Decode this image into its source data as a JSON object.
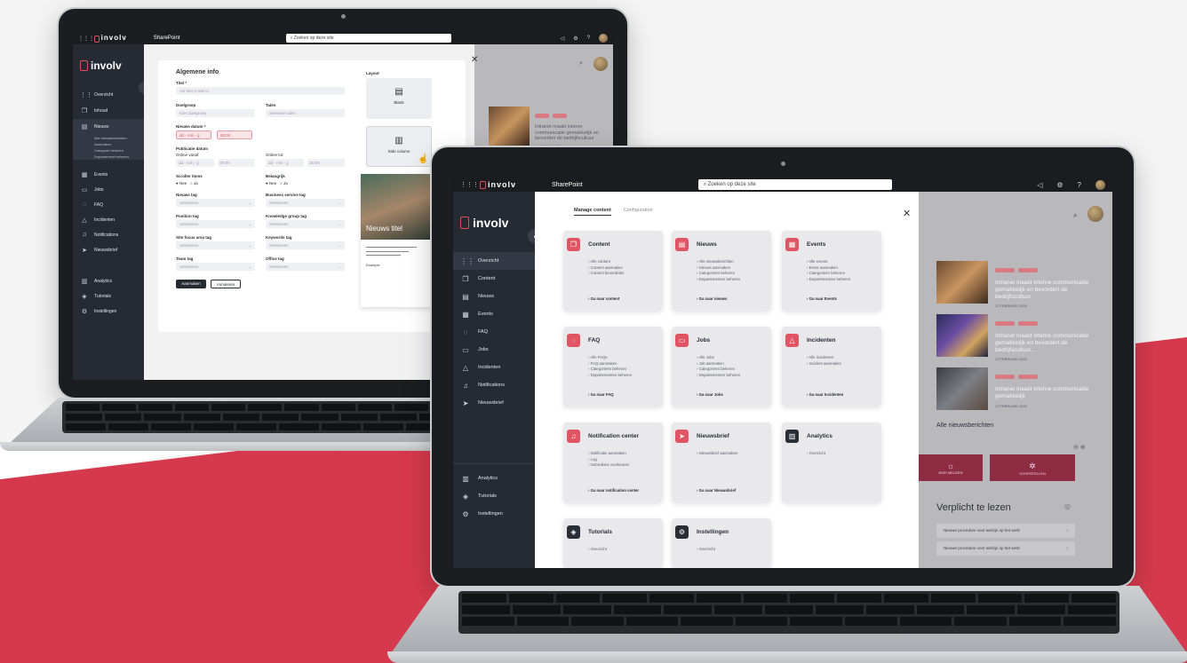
{
  "brand": {
    "logo_text": "involv",
    "logo_sub": "INTRANET MADE SIMPLE",
    "app_name": "SharePoint",
    "search_placeholder": "Zoeken op deze site"
  },
  "front": {
    "tabs": [
      "Manage content",
      "Configuration"
    ],
    "sidebar": [
      {
        "icon": "grid-icon",
        "glyph": "⋮⋮",
        "label": "Overzicht",
        "active": true
      },
      {
        "icon": "content-icon",
        "glyph": "❐",
        "label": "Content"
      },
      {
        "icon": "news-icon",
        "glyph": "▤",
        "label": "Nieuws"
      },
      {
        "icon": "calendar-icon",
        "glyph": "▦",
        "label": "Events"
      },
      {
        "icon": "faq-icon",
        "glyph": "◌",
        "label": "FAQ"
      },
      {
        "icon": "briefcase-icon",
        "glyph": "▭",
        "label": "Jobs"
      },
      {
        "icon": "warning-icon",
        "glyph": "△",
        "label": "Incidenten"
      },
      {
        "icon": "bell-icon",
        "glyph": "♫",
        "label": "Notifications"
      },
      {
        "icon": "send-icon",
        "glyph": "➤",
        "label": "Nieuwsbrief"
      }
    ],
    "sidebar_bottom": [
      {
        "icon": "analytics-icon",
        "glyph": "▥",
        "label": "Analytics"
      },
      {
        "icon": "tutorial-icon",
        "glyph": "◈",
        "label": "Tutorials"
      },
      {
        "icon": "settings-icon",
        "glyph": "⚙",
        "label": "Instellingen"
      }
    ],
    "tiles": [
      {
        "name": "Content",
        "icon": "content-icon",
        "glyph": "❐",
        "links": [
          "Alle content",
          "Content aanmaken",
          "Content beoordelen"
        ],
        "go": "Ga naar content"
      },
      {
        "name": "Nieuws",
        "icon": "news-icon",
        "glyph": "▤",
        "links": [
          "Alle nieuwsberichten",
          "Nieuws aanmaken",
          "Categorieën beheren",
          "Departementen beheren"
        ],
        "go": "Ga naar nieuws"
      },
      {
        "name": "Events",
        "icon": "calendar-icon",
        "glyph": "▦",
        "links": [
          "Alle events",
          "Event aanmaken",
          "Categorieën beheren",
          "Departementen beheren"
        ],
        "go": "Ga naar Events"
      },
      {
        "name": "FAQ",
        "icon": "faq-icon",
        "glyph": "◌",
        "links": [
          "Alle FAQs",
          "FAQ aanmaken",
          "Categorieën beheren",
          "Departementen beheren"
        ],
        "go": "Ga naar FAQ"
      },
      {
        "name": "Jobs",
        "icon": "briefcase-icon",
        "glyph": "▭",
        "links": [
          "Alle Jobs",
          "Job aanmaken",
          "Categorieën beheren",
          "Departementen beheren"
        ],
        "go": "Ga naar Jobs"
      },
      {
        "name": "Incidenten",
        "icon": "warning-icon",
        "glyph": "△",
        "links": [
          "Alle incidenten",
          "Incident aanmaken"
        ],
        "go": "Ga naar Incidenten"
      },
      {
        "name": "Notification center",
        "icon": "bell-icon",
        "glyph": "♫",
        "links": [
          "Notificatie aanmaken",
          "Log",
          "Gebruikers voorkeuren"
        ],
        "go": "Ga naar notification center"
      },
      {
        "name": "Nieuwsbrief",
        "icon": "send-icon",
        "glyph": "➤",
        "links": [
          "Nieuwsbrief aanmaken"
        ],
        "go": "Ga naar Nieuwsbrief"
      },
      {
        "name": "Analytics",
        "icon": "analytics-icon",
        "glyph": "▥",
        "links": [
          "Overzicht"
        ],
        "go": "",
        "dark": true
      },
      {
        "name": "Tutorials",
        "icon": "tutorial-icon",
        "glyph": "◈",
        "links": [
          "Overzicht"
        ],
        "go": "",
        "dark": true
      },
      {
        "name": "Instellingen",
        "icon": "settings-icon",
        "glyph": "⚙",
        "links": [
          "Overzicht"
        ],
        "go": "",
        "dark": true
      }
    ],
    "right": {
      "news": [
        {
          "title": "Intranet maakt interne communicatie gemakkelijk en bevordert de bedrijfscultuur",
          "date": "12 FEBRUARI 2024"
        },
        {
          "title": "Intranet maakt interne communicatie gemakkelijk en bevordert de bedrijfscultuur...",
          "date": "12 FEBRUARI 2024"
        },
        {
          "title": "Intranet maakt interne communicatie gemakkelijk",
          "date": "12 FEBRUARI 2024"
        }
      ],
      "all_news": "Alle nieuwsberichten",
      "btn_left": "IDEE MELDEN",
      "btn_right": "VOORSTELLEN",
      "required_title": "Verplicht te lezen",
      "required_items": [
        "Nieuwe procedure voor welzijn op het werk",
        "Nieuwe procedure voor welzijn op het werk"
      ]
    }
  },
  "back": {
    "sidebar": [
      {
        "icon": "grid-icon",
        "glyph": "⋮⋮",
        "label": "Overzicht"
      },
      {
        "icon": "content-icon",
        "glyph": "❐",
        "label": "Inhoud"
      },
      {
        "icon": "news-icon",
        "glyph": "▤",
        "label": "Nieuws",
        "active": true
      }
    ],
    "subitems": [
      "Alle nieuwsberichten",
      "Aanmaken",
      "Categorie beheren",
      "Departement beheren"
    ],
    "sidebar2": [
      {
        "icon": "calendar-icon",
        "glyph": "▦",
        "label": "Events"
      },
      {
        "icon": "briefcase-icon",
        "glyph": "▭",
        "label": "Jobs"
      },
      {
        "icon": "faq-icon",
        "glyph": "◌",
        "label": "FAQ"
      },
      {
        "icon": "warning-icon",
        "glyph": "△",
        "label": "Incidenten"
      },
      {
        "icon": "bell-icon",
        "glyph": "♫",
        "label": "Notifications"
      },
      {
        "icon": "send-icon",
        "glyph": "➤",
        "label": "Nieuwsbrief"
      }
    ],
    "sidebar_bottom": [
      {
        "icon": "analytics-icon",
        "glyph": "▥",
        "label": "Analytics"
      },
      {
        "icon": "tutorial-icon",
        "glyph": "◈",
        "label": "Tutorials"
      },
      {
        "icon": "settings-icon",
        "glyph": "⚙",
        "label": "Instellingen"
      }
    ],
    "form": {
      "heading": "Algemene info",
      "title_label": "Titel *",
      "title_ph": "Vul hier je titel in",
      "doelgroep": "Doelgroep",
      "doelgroep_ph": "Kies doelgroep",
      "talen": "Talen",
      "talen_ph": "Selecteer talen",
      "date_label": "Nieuws datum *",
      "date_ph": "dd - mm - jj",
      "time_ph": "00:00",
      "publish_label": "Publicatie datum",
      "from_label": "Online vanaf:",
      "to_label": "Online tot:",
      "scroller": "Scroller items",
      "important": "Belangrijk",
      "yes": "Nee",
      "no": "Ja",
      "fields": [
        [
          "Nieuws tag",
          "Business service tag"
        ],
        [
          "Position tag",
          "Knowledge group tag"
        ],
        [
          "Site focus area tag",
          "Keywords tag"
        ],
        [
          "Team tag",
          "Office tag"
        ]
      ],
      "select_ph": "Selecteren",
      "save": "Aanmaken",
      "cancel": "Annuleren",
      "layout": "Layout",
      "blank": "Blank",
      "side_column": "Side column",
      "preview_title": "Nieuws titel",
      "preview_label": "Example"
    },
    "right_title": "Intranet maakt interne communicatie gemakkelijk en bevordert de bedrijfscultuur",
    "right_date": "12 FEBRUARI 2024"
  }
}
